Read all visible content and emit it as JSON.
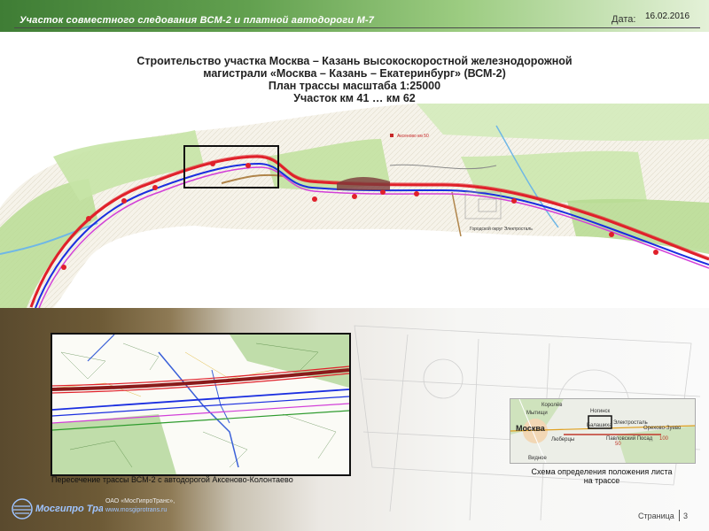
{
  "header": {
    "title": "Участок совместного следования ВСМ-2 и платной автодороги М-7",
    "date_label": "Дата:",
    "date_value": "16.02.2016"
  },
  "subtitle": {
    "line1": "Строительство участка Москва – Казань высокоскоростной железнодорожной",
    "line2": "магистрали «Москва – Казань – Екатеринбург» (ВСМ-2)",
    "line3": "План трассы масштаба 1:25000",
    "line4": "Участок км 41 … км 62"
  },
  "main_map": {
    "label_town": "Аксеново км 50",
    "label_district": "Городской округ Электросталь"
  },
  "detail_inset": {
    "caption": "Пересечение трассы ВСМ-2 с автодорогой Аксеново-Колонтаево"
  },
  "scheme": {
    "caption_line1": "Схема определения положения листа",
    "caption_line2": "на трассе",
    "places": [
      "Королёв",
      "Мытищи",
      "Балашиха",
      "Ногинск",
      "Москва",
      "Электросталь",
      "Люберцы",
      "Павловский Посад",
      "Орехово-Зуево",
      "Видное"
    ],
    "km_marks": [
      "50",
      "100"
    ]
  },
  "footer": {
    "logo_text": "Мосгипро Транс",
    "company": "ОАО «МосГипроТранс»,",
    "website": "www.mosgiprotrans.ru",
    "page_label": "Страница",
    "page_number": "3"
  },
  "colors": {
    "header_green": "#3f7d35",
    "route_red": "#e0202a",
    "route_blue": "#1a2ee0",
    "road_magenta": "#d23fd8",
    "forest_green": "#b9dc94"
  }
}
